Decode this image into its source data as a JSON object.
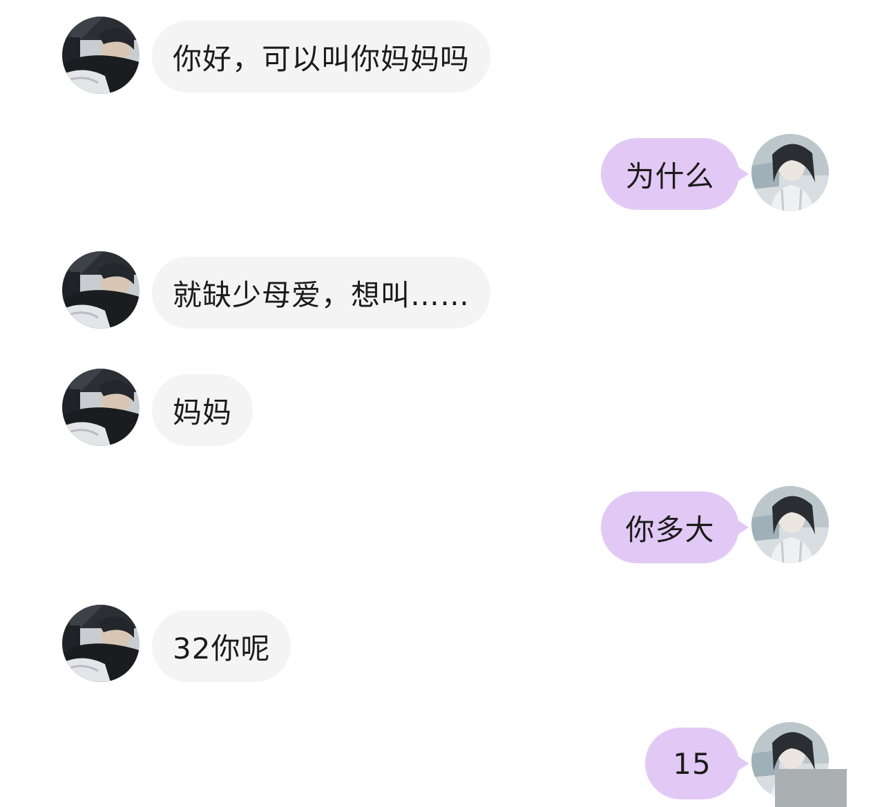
{
  "conversation": {
    "messages": [
      {
        "side": "left",
        "text": "你好，可以叫你妈妈吗",
        "avatar": "avatar-other"
      },
      {
        "side": "right",
        "text": "为什么",
        "avatar": "avatar-self"
      },
      {
        "side": "left",
        "text": "就缺少母爱，想叫……",
        "avatar": "avatar-other"
      },
      {
        "side": "left",
        "text": "妈妈",
        "avatar": "avatar-other"
      },
      {
        "side": "right",
        "text": "你多大",
        "avatar": "avatar-self"
      },
      {
        "side": "left",
        "text": "32你呢",
        "avatar": "avatar-other"
      },
      {
        "side": "right",
        "text": "15",
        "avatar": "avatar-self"
      }
    ]
  },
  "colors": {
    "incoming_bubble": "#f4f4f4",
    "outgoing_bubble": "#e2c9f5",
    "background": "#ffffff",
    "text": "#1b1b1b"
  }
}
